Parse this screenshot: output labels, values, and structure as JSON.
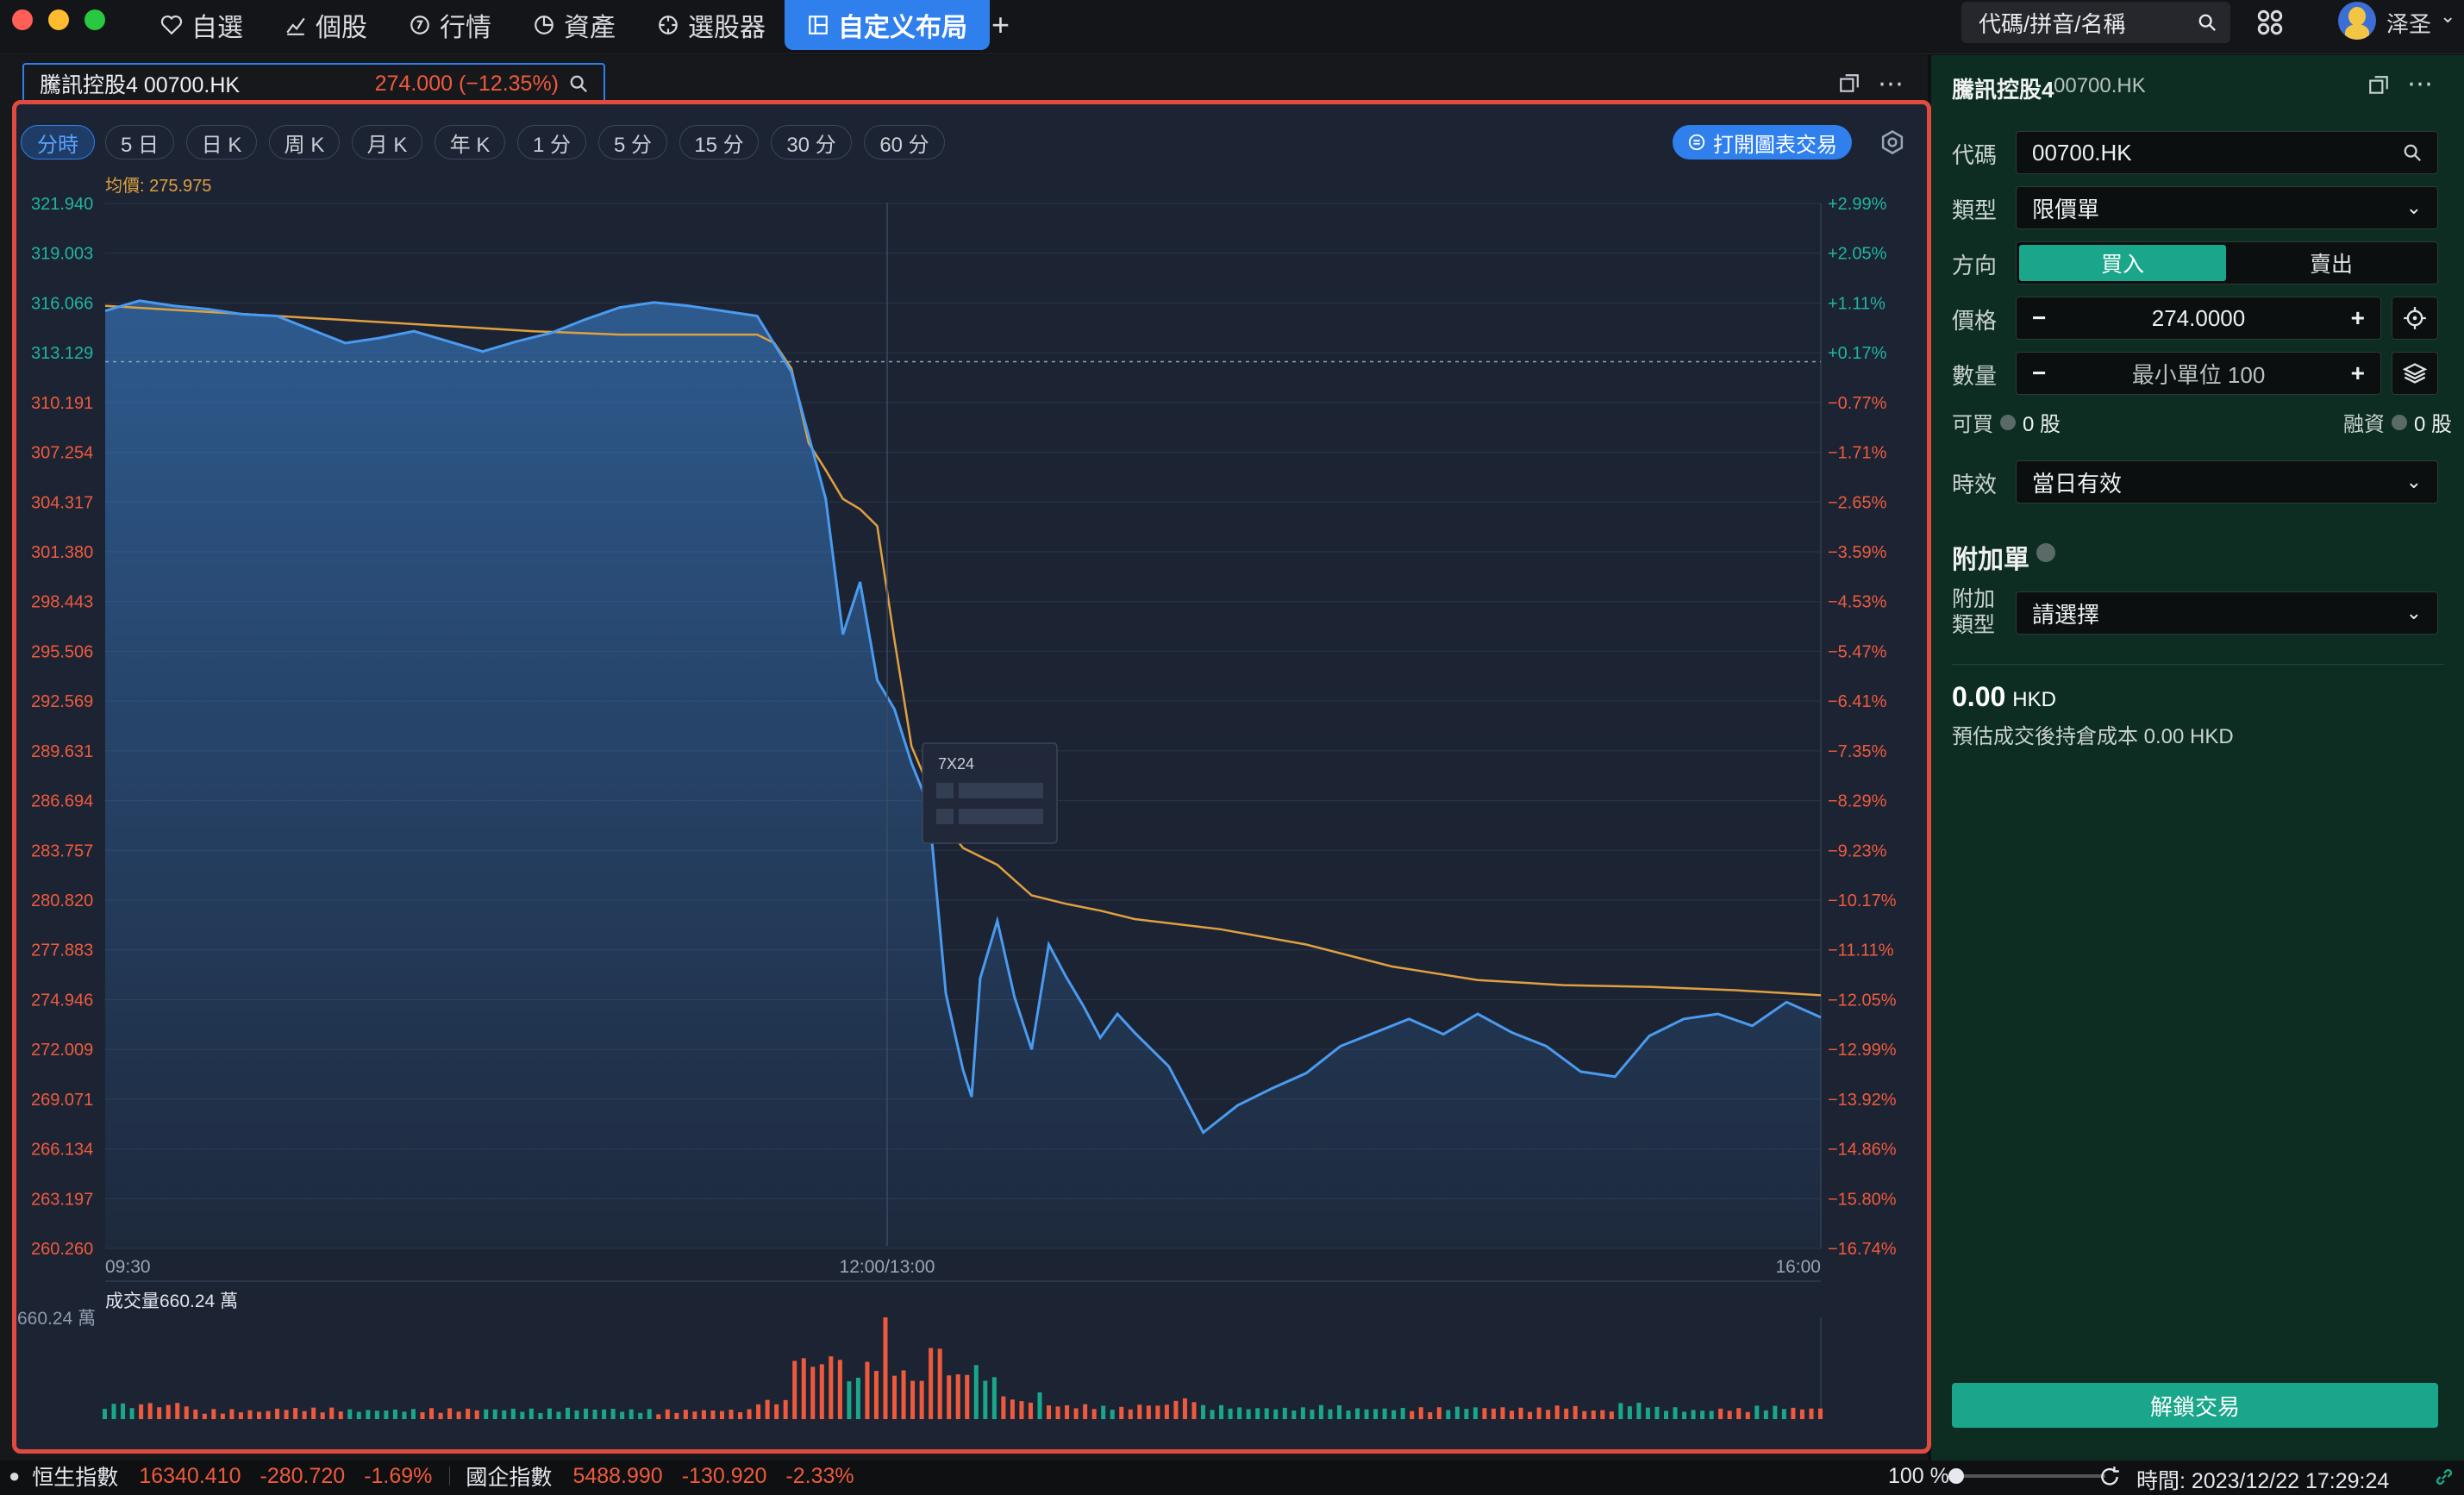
{
  "nav": {
    "items": [
      {
        "label": "自選",
        "icon": "heart-icon"
      },
      {
        "label": "個股",
        "icon": "line-chart-icon"
      },
      {
        "label": "行情",
        "icon": "quote-icon"
      },
      {
        "label": "資產",
        "icon": "pie-icon"
      },
      {
        "label": "選股器",
        "icon": "crosshair-icon"
      },
      {
        "label": "自定义布局",
        "icon": "layout-icon",
        "active": true
      }
    ],
    "add_label": "+",
    "search_placeholder": "代碼/拼音/名稱",
    "user_name": "泽圣"
  },
  "stock_header": {
    "name_code": "騰訊控股4 00700.HK",
    "price_change": "274.000 (−12.35%)"
  },
  "chart_toolbar": {
    "periods": [
      "分時",
      "5 日",
      "日 K",
      "周 K",
      "月 K",
      "年 K",
      "1 分",
      "5 分",
      "15 分",
      "30 分",
      "60 分"
    ],
    "active_period": "分時",
    "trade_button": "打開圖表交易"
  },
  "chart_data": {
    "type": "line",
    "avg_label": "均價: 275.975",
    "y_ticks": [
      "321.940",
      "319.003",
      "316.066",
      "313.129",
      "310.191",
      "307.254",
      "304.317",
      "301.380",
      "298.443",
      "295.506",
      "292.569",
      "289.631",
      "286.694",
      "283.757",
      "280.820",
      "277.883",
      "274.946",
      "272.009",
      "269.071",
      "266.134",
      "263.197",
      "260.260"
    ],
    "pct_ticks": [
      "+2.99%",
      "+2.05%",
      "+1.11%",
      "+0.17%",
      "−0.77%",
      "−1.71%",
      "−2.65%",
      "−3.59%",
      "−4.53%",
      "−5.47%",
      "−6.41%",
      "−7.35%",
      "−8.29%",
      "−9.23%",
      "−10.17%",
      "−11.11%",
      "−12.05%",
      "−12.99%",
      "−13.92%",
      "−14.86%",
      "−15.80%",
      "−16.74%"
    ],
    "x_ticks": [
      "09:30",
      "12:00/13:00",
      "16:00"
    ],
    "ylim": [
      260.26,
      321.94
    ],
    "prev_close": 312.6,
    "price_series": {
      "name": "價格",
      "x": [
        0,
        0.02,
        0.04,
        0.06,
        0.08,
        0.1,
        0.12,
        0.14,
        0.16,
        0.18,
        0.2,
        0.22,
        0.24,
        0.26,
        0.28,
        0.3,
        0.32,
        0.34,
        0.36,
        0.38,
        0.4,
        0.42,
        0.43,
        0.44,
        0.45,
        0.46,
        0.47,
        0.48,
        0.49,
        0.5,
        0.505,
        0.51,
        0.52,
        0.53,
        0.54,
        0.55,
        0.56,
        0.57,
        0.58,
        0.59,
        0.6,
        0.62,
        0.64,
        0.66,
        0.68,
        0.7,
        0.72,
        0.74,
        0.76,
        0.78,
        0.8,
        0.82,
        0.84,
        0.86,
        0.88,
        0.9,
        0.92,
        0.94,
        0.96,
        0.98,
        1.0
      ],
      "values": [
        315.6,
        316.2,
        315.9,
        315.7,
        315.4,
        315.3,
        314.5,
        313.7,
        314.0,
        314.4,
        313.8,
        313.2,
        313.8,
        314.3,
        315.1,
        315.8,
        316.1,
        315.9,
        315.6,
        315.3,
        312.0,
        304.5,
        296.5,
        299.6,
        293.8,
        292.1,
        288.9,
        286.4,
        275.3,
        270.8,
        269.2,
        276.2,
        279.6,
        275.1,
        272.0,
        278.2,
        276.3,
        274.6,
        272.7,
        274.1,
        273.0,
        271.0,
        267.1,
        268.7,
        269.7,
        270.6,
        272.2,
        273.0,
        273.8,
        272.9,
        274.1,
        273.0,
        272.2,
        270.7,
        270.4,
        272.8,
        273.8,
        274.1,
        273.4,
        274.8,
        273.9
      ]
    },
    "avg_series": {
      "name": "均價",
      "x": [
        0,
        0.05,
        0.1,
        0.15,
        0.2,
        0.25,
        0.3,
        0.35,
        0.38,
        0.39,
        0.4,
        0.41,
        0.42,
        0.43,
        0.44,
        0.45,
        0.46,
        0.47,
        0.48,
        0.49,
        0.5,
        0.52,
        0.54,
        0.56,
        0.58,
        0.6,
        0.65,
        0.7,
        0.75,
        0.8,
        0.85,
        0.9,
        0.95,
        1.0
      ],
      "values": [
        315.9,
        315.6,
        315.3,
        315.0,
        314.7,
        314.4,
        314.2,
        314.2,
        314.2,
        313.7,
        312.2,
        307.8,
        306.2,
        304.5,
        303.9,
        302.9,
        296.2,
        289.9,
        287.5,
        285.2,
        283.9,
        282.9,
        281.1,
        280.6,
        280.2,
        279.7,
        279.1,
        278.2,
        276.9,
        276.1,
        275.8,
        275.7,
        275.5,
        275.2
      ]
    },
    "volume": {
      "label": "成交量660.24 萬",
      "max_label": "660.24 萬",
      "max": 660.24
    },
    "tooltip_label": "7X24"
  },
  "order_panel": {
    "title": "騰訊控股4",
    "code": "00700.HK",
    "labels": {
      "code": "代碼",
      "type": "類型",
      "direction": "方向",
      "price": "價格",
      "quantity": "數量",
      "can_buy": "可買",
      "margin": "融資",
      "validity": "時效",
      "attach": "附加單",
      "attach_type": "附加類型"
    },
    "code_value": "00700.HK",
    "type_value": "限價單",
    "buy_label": "買入",
    "sell_label": "賣出",
    "price_value": "274.0000",
    "quantity_placeholder": "最小單位 100",
    "can_buy_value": "0 股",
    "margin_value": "0 股",
    "validity_value": "當日有效",
    "attach_value": "請選擇",
    "amount": "0.00",
    "currency": "HKD",
    "estimate_text": "預估成交後持倉成本 0.00 HKD",
    "unlock_button": "解鎖交易"
  },
  "status_bar": {
    "index1_name": "恒生指數",
    "index1_value": "16340.410",
    "index1_change": "-280.720",
    "index1_pct": "-1.69%",
    "index2_name": "國企指數",
    "index2_value": "5488.990",
    "index2_change": "-130.920",
    "index2_pct": "-2.33%",
    "zoom": "100 %",
    "time": "時間: 2023/12/22 17:29:24"
  },
  "colors": {
    "accent": "#2f80ed",
    "up_teal": "#1aa68a",
    "down_red": "#f05a3c",
    "price_line": "#4a9bf0",
    "avg_line": "#e0a040",
    "frame_red": "#e04a3f"
  }
}
